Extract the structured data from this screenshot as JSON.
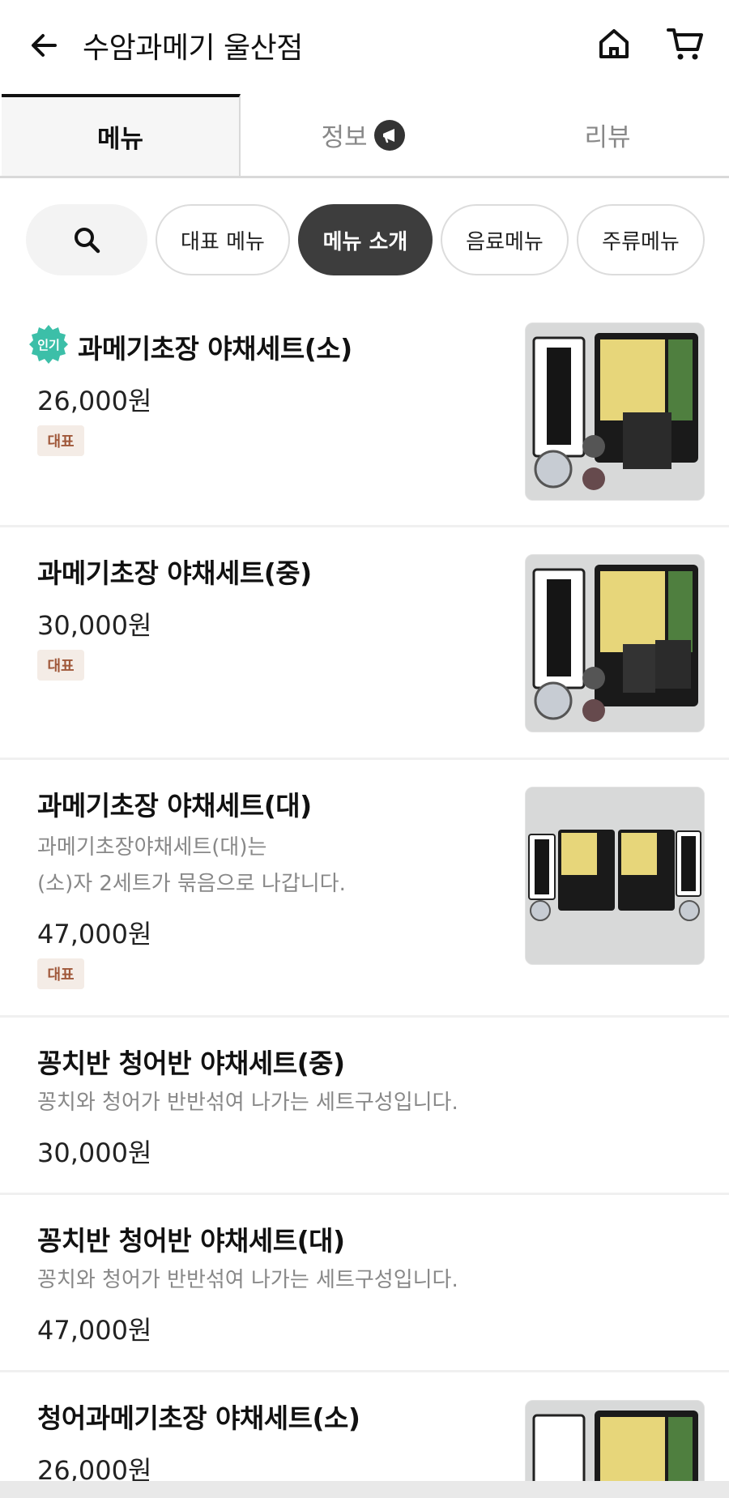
{
  "header": {
    "title": "수암과메기 울산점",
    "back_icon": "arrow-left-icon",
    "home_icon": "home-icon",
    "cart_icon": "cart-icon"
  },
  "tabs": [
    {
      "label": "메뉴",
      "active": true
    },
    {
      "label": "정보",
      "icon": "megaphone-icon"
    },
    {
      "label": "리뷰"
    }
  ],
  "chips": {
    "search_icon": "search-icon",
    "items": [
      {
        "label": "대표 메뉴",
        "active": false
      },
      {
        "label": "메뉴 소개",
        "active": true
      },
      {
        "label": "음료메뉴",
        "active": false
      },
      {
        "label": "주류메뉴",
        "active": false
      }
    ]
  },
  "menu_items": [
    {
      "name": "과메기초장 야채세트(소)",
      "price": "26,000원",
      "badge": "대표",
      "popular_badge": "인기",
      "has_image": true
    },
    {
      "name": "과메기초장 야채세트(중)",
      "price": "30,000원",
      "badge": "대표",
      "has_image": true
    },
    {
      "name": "과메기초장 야채세트(대)",
      "desc_line1": "과메기초장야채세트(대)는",
      "desc_line2": "(소)자 2세트가 묶음으로 나갑니다.",
      "price": "47,000원",
      "badge": "대표",
      "has_image": true
    },
    {
      "name": "꽁치반 청어반 야채세트(중)",
      "desc_line1": "꽁치와 청어가 반반섞여 나가는 세트구성입니다.",
      "price": "30,000원"
    },
    {
      "name": "꽁치반 청어반 야채세트(대)",
      "desc_line1": "꽁치와 청어가 반반섞여 나가는 세트구성입니다.",
      "price": "47,000원"
    },
    {
      "name": "청어과메기초장 야채세트(소)",
      "price": "26,000원",
      "has_image": true
    }
  ],
  "colors": {
    "active_chip_bg": "#3d3d3d",
    "badge_bg": "#f4ece6",
    "badge_text": "#a0583a",
    "popular_badge": "#3cbfa8"
  }
}
